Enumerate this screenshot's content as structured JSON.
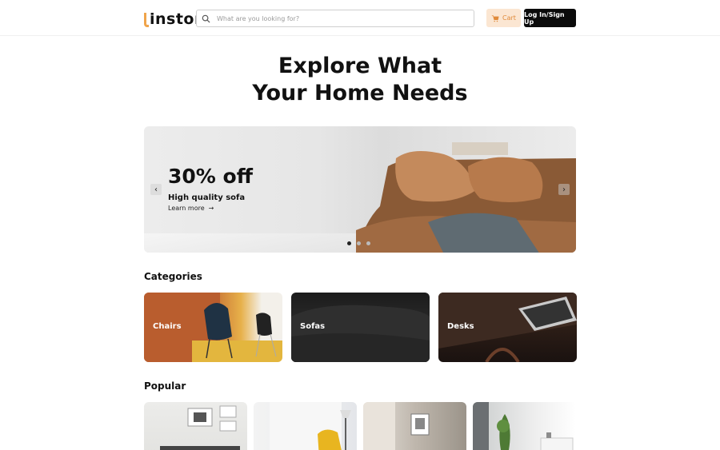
{
  "header": {
    "logo_text": "instor",
    "search_placeholder": "What are you looking for?",
    "cart_label": "Cart",
    "login_label": "Log In/Sign Up"
  },
  "hero": {
    "title_line1": "Explore What",
    "title_line2": "Your Home Needs"
  },
  "banner": {
    "promo_title": "30% off",
    "promo_subtitle": "High quality sofa",
    "link_label": "Learn more",
    "slides": 3,
    "active_slide": 1
  },
  "categories": {
    "title": "Categories",
    "items": [
      {
        "label": "Chairs"
      },
      {
        "label": "Sofas"
      },
      {
        "label": "Desks"
      }
    ]
  },
  "popular": {
    "title": "Popular"
  },
  "colors": {
    "accent": "#f0a44b",
    "cart_bg": "#fbe6d2",
    "dark": "#0b0b0b"
  }
}
